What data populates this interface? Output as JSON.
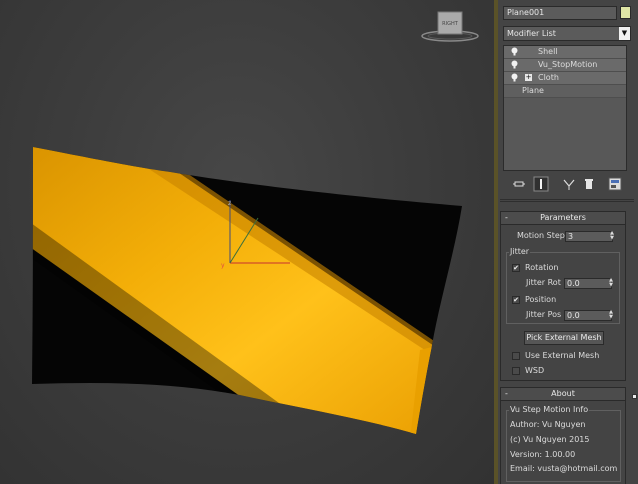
{
  "viewport": {
    "viewcube_label": "RIGHT",
    "axis_z_label": "z",
    "axis_y_label": "y"
  },
  "panel": {
    "object_name": "Plane001",
    "object_color": "#e0e6a6",
    "modifier_list_label": "Modifier List",
    "stack": [
      {
        "label": "Shell",
        "icon": "lightbulb-icon",
        "expand": false
      },
      {
        "label": "Vu_StopMotion",
        "icon": "lightbulb-icon",
        "expand": false
      },
      {
        "label": "Cloth",
        "icon": "lightbulb-icon",
        "expand": true,
        "expand_symbol": "+"
      },
      {
        "label": "Plane",
        "icon": "",
        "expand": false
      }
    ],
    "toolbar_icons": [
      "pin-stack-icon",
      "show-end-result-icon",
      "make-unique-icon",
      "remove-modifier-icon",
      "configure-sets-icon"
    ]
  },
  "parameters": {
    "title": "Parameters",
    "collapse_symbol": "-",
    "motion_step_label": "Motion Step",
    "motion_step_value": "3",
    "jitter_group_label": "Jitter",
    "rotation_label": "Rotation",
    "rotation_checked": true,
    "jitter_rot_label": "Jitter Rot",
    "jitter_rot_value": "0.0",
    "position_label": "Position",
    "position_checked": true,
    "jitter_pos_label": "Jitter Pos",
    "jitter_pos_value": "0.0",
    "pick_button_label": "Pick External Mesh",
    "use_external_label": "Use External Mesh",
    "use_external_checked": false,
    "wsd_label": "WSD",
    "wsd_checked": false
  },
  "about": {
    "title": "About",
    "collapse_symbol": "-",
    "group_label": "Vu Step Motion Info",
    "author": "Author: Vu Nguyen",
    "copyright": "(c) Vu Nguyen 2015",
    "version": "Version: 1.00.00",
    "email": "Email: vusta@hotmail.com"
  },
  "colors": {
    "cloth_yellow": "#f0a800",
    "cloth_black": "#050505",
    "panel_bg": "#444444",
    "check_mark": "✔"
  }
}
